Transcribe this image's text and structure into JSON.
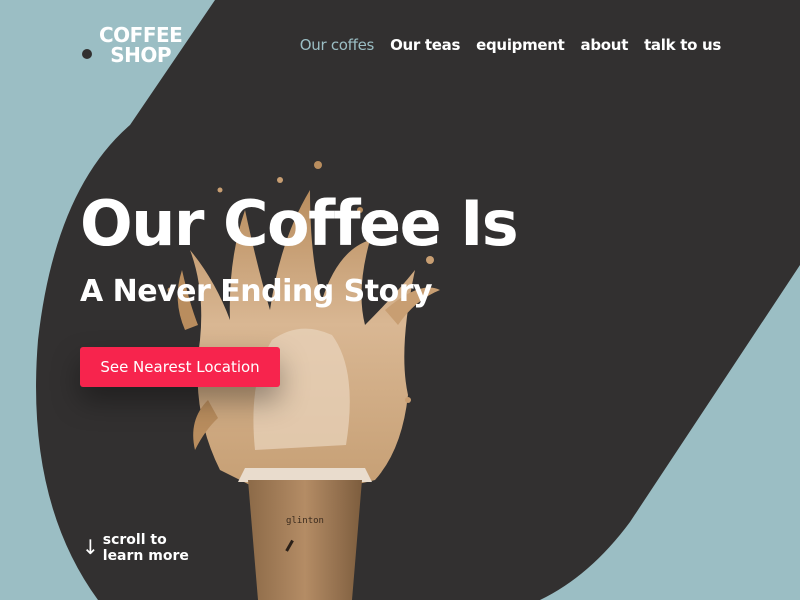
{
  "brand": {
    "line1": "COFFEE",
    "line2": "SHOP"
  },
  "nav": {
    "items": [
      {
        "label": "Our coffes",
        "active": true
      },
      {
        "label": "Our teas"
      },
      {
        "label": "equipment"
      },
      {
        "label": "about"
      },
      {
        "label": "talk to us"
      }
    ]
  },
  "hero": {
    "title": "Our Coffee Is",
    "subtitle": "A Never Ending Story",
    "cta_label": "See Nearest Location"
  },
  "scroll_hint": {
    "line1": "scroll to",
    "line2": "learn more"
  },
  "cup": {
    "brand_text": "glinton"
  },
  "colors": {
    "background": "#9bbec4",
    "dark_shape": "#323030",
    "accent": "#f7244d",
    "active_nav": "#9bbec4",
    "text": "#ffffff"
  }
}
